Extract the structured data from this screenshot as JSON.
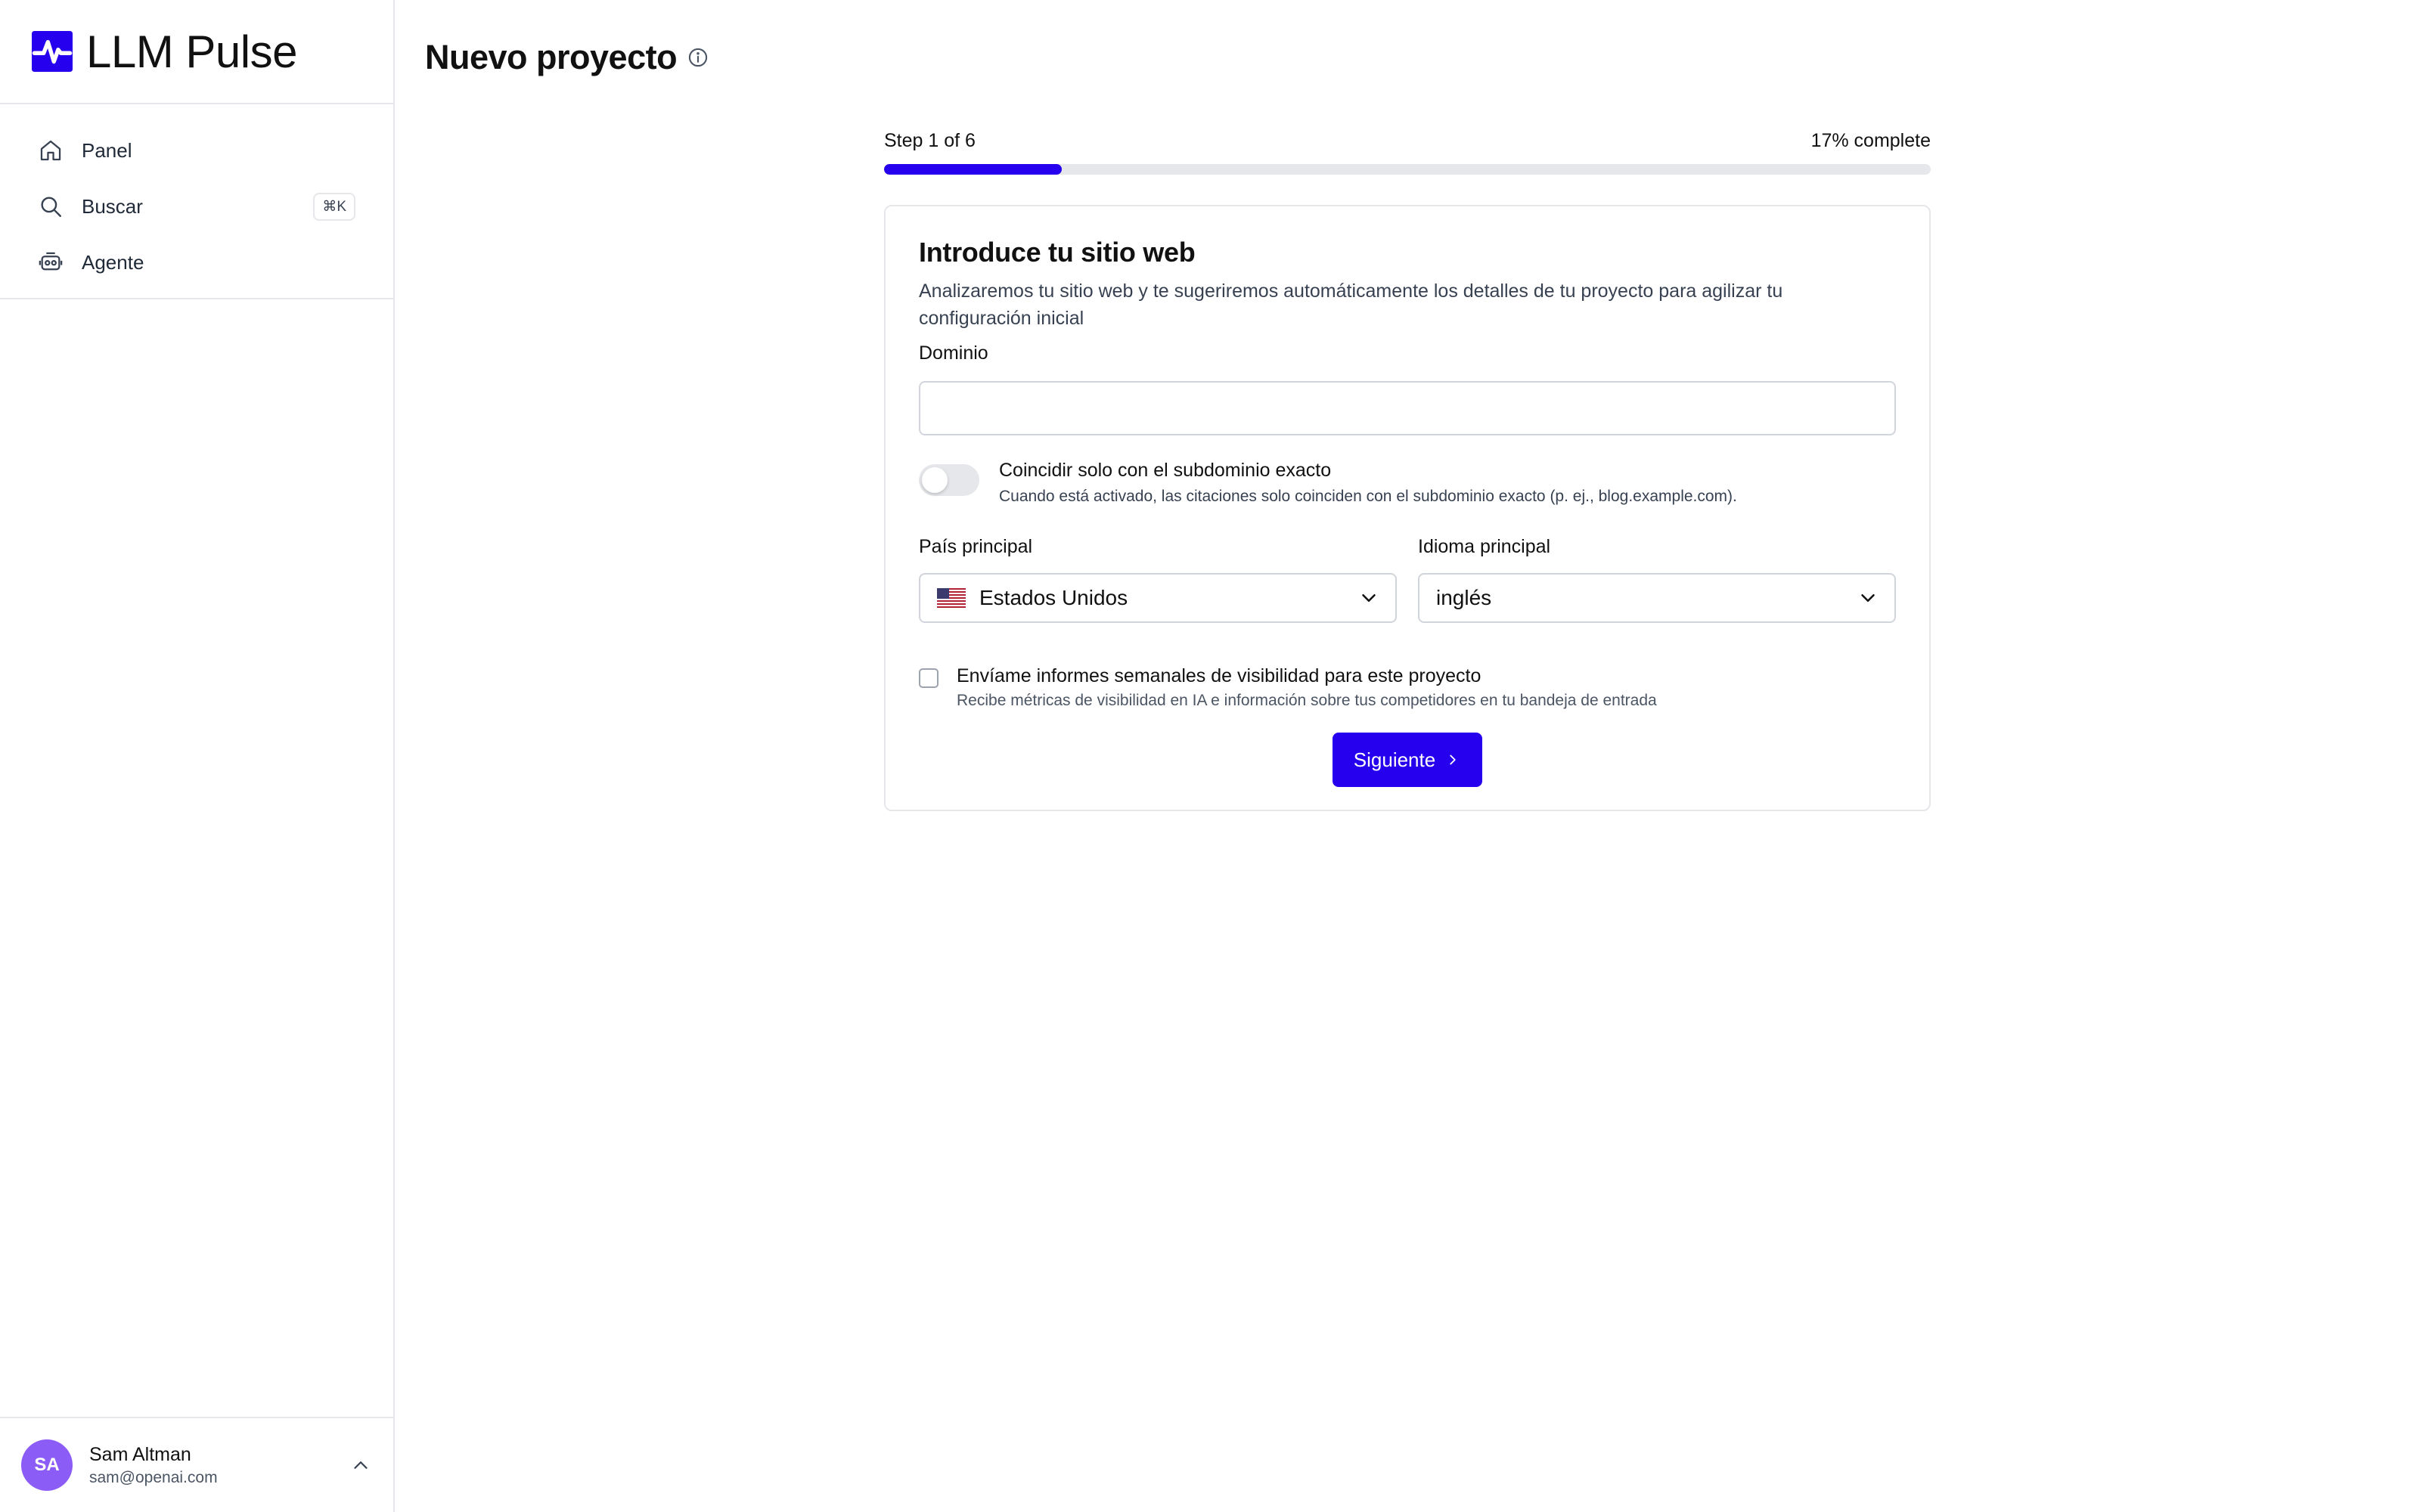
{
  "colors": {
    "accent": "#2600ee",
    "border": "#e5e7eb",
    "avatar": "#8b5cf6"
  },
  "app": {
    "name": "LLM Pulse",
    "logo_icon": "pulse-logo-icon"
  },
  "sidebar": {
    "items": [
      {
        "label": "Panel",
        "icon": "home-icon"
      },
      {
        "label": "Buscar",
        "icon": "search-icon",
        "shortcut": "⌘K"
      },
      {
        "label": "Agente",
        "icon": "robot-icon"
      }
    ],
    "user": {
      "initials": "SA",
      "name": "Sam Altman",
      "email": "sam@openai.com"
    }
  },
  "page": {
    "title": "Nuevo proyecto",
    "title_icon": "info-icon"
  },
  "wizard": {
    "step_text": "Step 1 of 6",
    "percent_text": "17% complete",
    "progress": 0.17
  },
  "form": {
    "title": "Introduce tu sitio web",
    "description": "Analizaremos tu sitio web y te sugeriremos automáticamente los detalles de tu proyecto para agilizar tu configuración inicial",
    "domain_label": "Dominio",
    "domain_value": "",
    "subdomain_toggle": {
      "on": false,
      "title": "Coincidir solo con el subdominio exacto",
      "description": "Cuando está activado, las citaciones solo coinciden con el subdominio exacto (p. ej., blog.example.com)."
    },
    "country": {
      "label": "País principal",
      "value": "Estados Unidos",
      "flag": "us-flag-icon"
    },
    "language": {
      "label": "Idioma principal",
      "value": "inglés"
    },
    "weekly_reports": {
      "checked": false,
      "title": "Envíame informes semanales de visibilidad para este proyecto",
      "description": "Recibe métricas de visibilidad en IA e información sobre tus competidores en tu bandeja de entrada"
    },
    "next_label": "Siguiente"
  }
}
